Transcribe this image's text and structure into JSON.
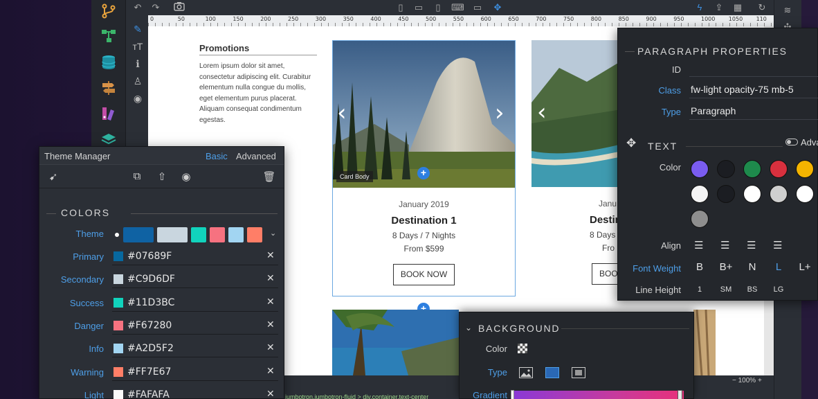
{
  "canvas_page": {
    "promo_title": "Promotions",
    "promo_text": "Lorem ipsum dolor sit amet, consectetur adipiscing elit. Curabitur elementum nulla congue du mollis, eget elementum purus placerat. Aliquam consequat condimentum egestas.",
    "card1": {
      "badge": "Card Body",
      "date": "January 2019",
      "title": "Destination 1",
      "line1": "8 Days / 7 Nights",
      "line2": "From $599",
      "button": "BOOK NOW"
    },
    "card2": {
      "date": "Janu",
      "title": "Destin",
      "line1": "8 Days",
      "line2": "Fro",
      "button": "BOO"
    }
  },
  "ruler_ticks": [
    "0",
    "50",
    "100",
    "150",
    "200",
    "250",
    "300",
    "350",
    "400",
    "450",
    "500",
    "550",
    "600",
    "650",
    "700",
    "750",
    "800",
    "850",
    "900",
    "950",
    "1000",
    "1050",
    "110"
  ],
  "status": {
    "breadcrumb": "jumbotron.jumbotron-fluid > div.container.text-center",
    "zoom": "− 100% +"
  },
  "theme_manager": {
    "title": "Theme Manager",
    "tab_basic": "Basic",
    "tab_advanced": "Advanced",
    "section": "COLORS",
    "theme_label": "Theme",
    "theme_swatches": [
      "#0f62a3",
      "#c9d6df",
      "#11d3bc",
      "#f67280",
      "#a2d5f2",
      "#ff7e67"
    ],
    "rows": [
      {
        "label": "Primary",
        "value": "#07689F",
        "color": "#07689f"
      },
      {
        "label": "Secondary",
        "value": "#C9D6DF",
        "color": "#c9d6df"
      },
      {
        "label": "Success",
        "value": "#11D3BC",
        "color": "#11d3bc"
      },
      {
        "label": "Danger",
        "value": "#F67280",
        "color": "#f67280"
      },
      {
        "label": "Info",
        "value": "#A2D5F2",
        "color": "#a2d5f2"
      },
      {
        "label": "Warning",
        "value": "#FF7E67",
        "color": "#ff7e67"
      },
      {
        "label": "Light",
        "value": "#FAFAFA",
        "color": "#fafafa"
      }
    ]
  },
  "paragraph_props": {
    "section": "PARAGRAPH PROPERTIES",
    "id_label": "ID",
    "id_value": "",
    "class_label": "Class",
    "class_value": "fw-light opacity-75 mb-5",
    "type_label": "Type",
    "type_value": "Paragraph",
    "text_section": "TEXT",
    "advanced_toggle": "Adva",
    "color_label": "Color",
    "colors": [
      "#7a5cf0",
      "#1b1d22",
      "#1e8a4c",
      "#d8303e",
      "#f4b400",
      "#f4f4f4",
      "#1b1d22",
      "#ffffff",
      "#cfcfcf",
      "#ffffff",
      "#8e8e8e"
    ],
    "align_label": "Align",
    "font_weight_label": "Font Weight",
    "font_weights": [
      "B",
      "B+",
      "N",
      "L",
      "L+"
    ],
    "line_height_label": "Line Height",
    "line_heights": [
      "1",
      "SM",
      "BS",
      "LG"
    ]
  },
  "background_panel": {
    "section": "BACKGROUND",
    "color_label": "Color",
    "type_label": "Type",
    "gradient_label": "Gradient"
  }
}
